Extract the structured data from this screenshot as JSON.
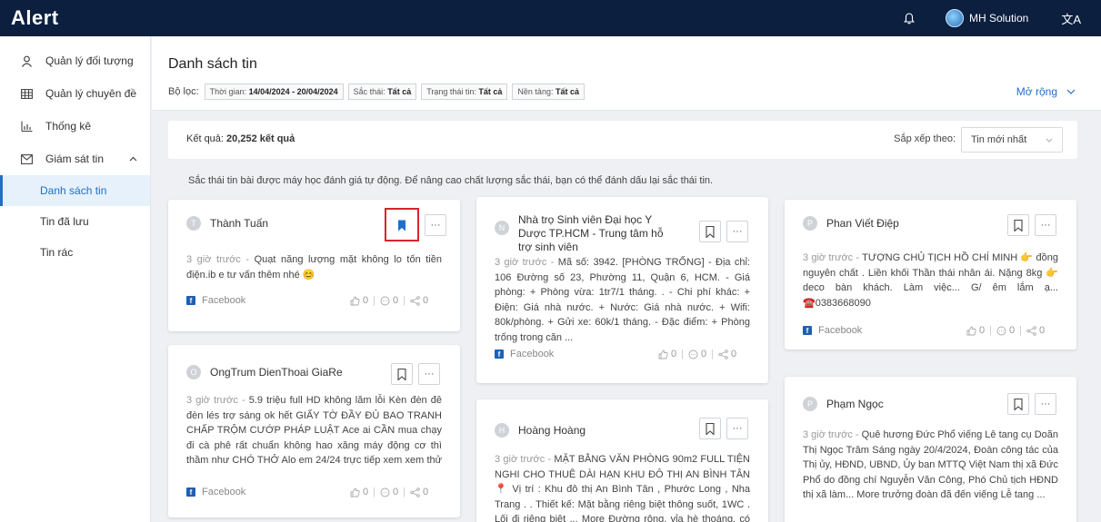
{
  "app": {
    "logo": "Alert",
    "user_name": "MH Solution",
    "lang_icon": "文A"
  },
  "sidebar": {
    "items": [
      {
        "label": "Quản lý đối tượng",
        "icon": "person-icon"
      },
      {
        "label": "Quản lý chuyên đề",
        "icon": "table-icon"
      },
      {
        "label": "Thống kê",
        "icon": "chart-icon"
      },
      {
        "label": "Giám sát tin",
        "icon": "mail-icon",
        "chevron": "^"
      }
    ],
    "sub_items": [
      {
        "label": "Danh sách tin",
        "active": true
      },
      {
        "label": "Tin đã lưu"
      },
      {
        "label": "Tin rác"
      }
    ]
  },
  "header": {
    "title": "Danh sách tin",
    "filter_label": "Bộ lọc:",
    "chips": [
      {
        "label": "Thời gian: ",
        "value": "14/04/2024 - 20/04/2024"
      },
      {
        "label": "Sắc thái: ",
        "value": "Tất cả"
      },
      {
        "label": "Trạng thái tin: ",
        "value": "Tất cả"
      },
      {
        "label": "Nền tảng: ",
        "value": "Tất cả"
      }
    ],
    "expand_label": "Mở rộng"
  },
  "results": {
    "prefix": "Kết quả: ",
    "count": "20,252 kết quả",
    "sort_label": "Sắp xếp theo:",
    "sort_value": "Tin mới nhất"
  },
  "notice": "Sắc thái tin bài được máy học đánh giá tự động. Để nâng cao chất lượng sắc thái, bạn có thể đánh dấu lại sắc thái tin.",
  "cards": [
    {
      "initial": "T",
      "name": "Thành Tuấn",
      "time": "3 giờ trước",
      "text": "Quạt năng lượng mặt không lo tốn tiền điện.ib e tư vấn thêm nhé 😊",
      "platform": "Facebook",
      "likes": "0",
      "comments": "0",
      "shares": "0",
      "bookmarked": true
    },
    {
      "initial": "O",
      "name": "OngTrum DienThoai GiaRe",
      "time": "3 giờ trước",
      "text": "5.9 triệu full HD không lăm lỗi Kèn đèn đê đèn lés trợ sáng ok hết GIẤY TỜ ĐẦY ĐỦ BAO TRANH CHẤP TRỘM CƯỚP PHÁP LUẬT Ace ai CẦN mua chạy đi cà phê rất chuẩn không hao xăng máy động cơ thì thầm như CHÓ THỞ Alo em 24/24 trực tiếp xem xem thử ...",
      "platform": "Facebook",
      "likes": "0",
      "comments": "0",
      "shares": "0",
      "bookmarked": false
    },
    {
      "initial": "N",
      "name": "Nhà trọ Sinh viên Đại học Y Dược TP.HCM - Trung tâm hỗ trợ sinh viên",
      "time": "3 giờ trước",
      "text": "Mã số: 3942. [PHÒNG TRỐNG] - Địa chỉ: 106 Đường số 23, Phường 11, Quận 6, HCM. - Giá phòng: + Phòng vừa: 1tr7/1 tháng. . - Chi phí khác: + Điện: Giá nhà nước. + Nước: Giá nhà nước. + Wifi: 80k/phòng. + Gửi xe: 60k/1 tháng. - Đặc điểm: + Phòng trống trong căn ...",
      "platform": "Facebook",
      "likes": "0",
      "comments": "0",
      "shares": "0",
      "bookmarked": false
    },
    {
      "initial": "H",
      "name": "Hoàng Hoàng",
      "time": "3 giờ trước",
      "text": "MẶT BẰNG VĂN PHÒNG 90m2 FULL TIỆN NGHI CHO THUÊ DÀI HẠN KHU ĐÔ THỊ AN BÌNH TÂN 📍 Vị trí : Khu đô thị An Bình Tân , Phước Long , Nha Trang . . Thiết kế: Mặt bằng riêng biệt thông suốt, 1WC . Lối đi riêng biệt ... More Đường rộng, vỉa hè thoáng, có chỗ ...",
      "platform": "Facebook",
      "likes": "0",
      "comments": "0",
      "shares": "0",
      "bookmarked": false
    },
    {
      "initial": "P",
      "name": "Phan Viết Điệp",
      "time": "3 giờ trước",
      "text": "TƯỢNG CHỦ TỊCH HỒ CHÍ MINH 👉 đồng nguyên chất . Liền khối Thần thái nhân ái. Nặng 8kg 👉 deco bàn khách. Làm việc... G/ êm lắm ạ... ☎️0383668090",
      "platform": "Facebook",
      "likes": "0",
      "comments": "0",
      "shares": "0",
      "bookmarked": false
    },
    {
      "initial": "P",
      "name": "Phạm Ngọc",
      "time": "3 giờ trước",
      "text": "Quê hương Đức Phổ viếng Lê tang cụ Doãn Thị Ngọc Trâm Sáng ngày 20/4/2024, Đoàn công tác của Thị ủy, HĐND, UBND, Ủy ban MTTQ Việt Nam thị xã Đức Phổ do đồng chí Nguyễn Văn Công, Phó Chủ tịch HĐND thị xã làm... More trưởng đoàn đã đến viếng Lễ tang ...",
      "platform": "Facebook",
      "likes": "0",
      "comments": "0",
      "shares": "0",
      "bookmarked": false
    }
  ]
}
